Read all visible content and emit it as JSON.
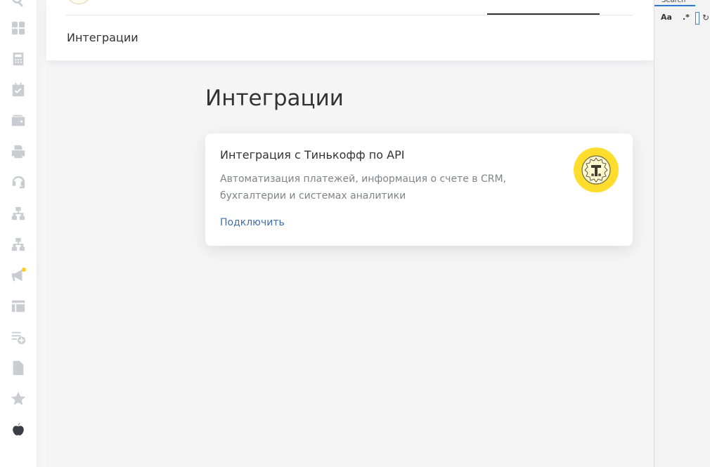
{
  "sidebar": {
    "icons": [
      "search-icon",
      "dashboard-icon",
      "calculator-icon",
      "calendar-check-icon",
      "wallet-icon",
      "printer-icon",
      "headset-icon",
      "sitemap-icon",
      "sitemap-alt-icon",
      "megaphone-icon",
      "layout-icon",
      "playlist-add-icon",
      "document-icon",
      "star-icon",
      "apple-icon"
    ]
  },
  "header": {
    "breadcrumb": "Интеграции"
  },
  "main": {
    "title": "Интеграции",
    "card": {
      "title": "Интеграция с Тинькофф по API",
      "description": "Автоматизация платежей, информация о счете в CRM, бухгалтерии и системах аналитики",
      "link": "Подключить",
      "logo_color": "#ffdd2d"
    }
  },
  "search_panel": {
    "tab": "Search",
    "match_case": "Aa",
    "regex": ".*"
  }
}
